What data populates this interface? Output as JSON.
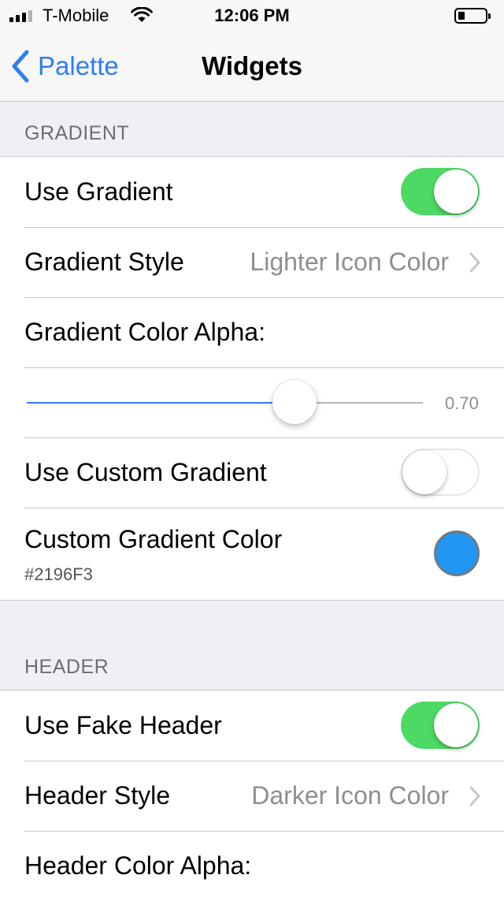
{
  "status_bar": {
    "carrier": "T-Mobile",
    "time": "12:06 PM",
    "icons": [
      "signal-icon",
      "wifi-icon",
      "battery-icon"
    ]
  },
  "nav": {
    "back_label": "Palette",
    "title": "Widgets"
  },
  "sections": {
    "gradient": {
      "header": "GRADIENT",
      "use_gradient": {
        "label": "Use Gradient",
        "on": true
      },
      "gradient_style": {
        "label": "Gradient Style",
        "value": "Lighter Icon Color"
      },
      "gradient_alpha": {
        "label": "Gradient Color Alpha:",
        "value": 0.7,
        "display": "0.70"
      },
      "use_custom_gradient": {
        "label": "Use Custom Gradient",
        "on": false
      },
      "custom_gradient_color": {
        "label": "Custom Gradient Color",
        "hex": "#2196F3"
      }
    },
    "header": {
      "header": "HEADER",
      "use_fake_header": {
        "label": "Use Fake Header",
        "on": true
      },
      "header_style": {
        "label": "Header Style",
        "value": "Darker Icon Color"
      },
      "header_alpha": {
        "label": "Header Color Alpha:"
      }
    }
  },
  "colors": {
    "switch_on": "#4cd964",
    "tint": "#2f7df6",
    "swatch": "#2196F3",
    "background": "#efeff4"
  }
}
